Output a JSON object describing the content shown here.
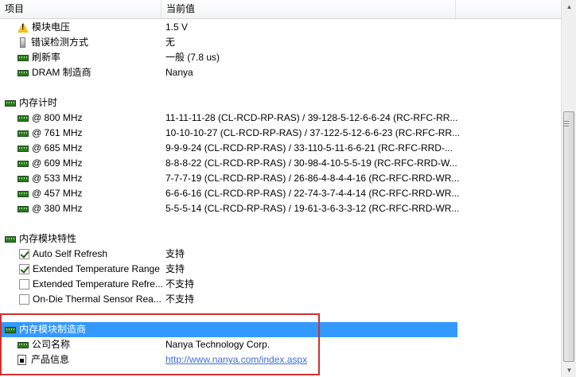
{
  "header": {
    "col_item": "项目",
    "col_value": "当前值"
  },
  "rows": [
    {
      "icon": "warning-icon",
      "label": "模块电压",
      "value": "1.5 V"
    },
    {
      "icon": "detection-icon",
      "label": "错误检测方式",
      "value": "无"
    },
    {
      "icon": "memory-icon",
      "label": "刷新率",
      "value": "一般 (7.8 us)"
    },
    {
      "icon": "memory-icon",
      "label": "DRAM 制造商",
      "value": "Nanya"
    },
    {
      "icon": "memory-icon",
      "label": "内存计时",
      "value": ""
    },
    {
      "icon": "memory-icon",
      "label": "@ 800 MHz",
      "value": "11-11-11-28  (CL-RCD-RP-RAS) / 39-128-5-12-6-6-24  (RC-RFC-RR..."
    },
    {
      "icon": "memory-icon",
      "label": "@ 761 MHz",
      "value": "10-10-10-27  (CL-RCD-RP-RAS) / 37-122-5-12-6-6-23  (RC-RFC-RR..."
    },
    {
      "icon": "memory-icon",
      "label": "@ 685 MHz",
      "value": "9-9-9-24  (CL-RCD-RP-RAS) / 33-110-5-11-6-6-21  (RC-RFC-RRD-..."
    },
    {
      "icon": "memory-icon",
      "label": "@ 609 MHz",
      "value": "8-8-8-22  (CL-RCD-RP-RAS) / 30-98-4-10-5-5-19  (RC-RFC-RRD-W..."
    },
    {
      "icon": "memory-icon",
      "label": "@ 533 MHz",
      "value": "7-7-7-19  (CL-RCD-RP-RAS) / 26-86-4-8-4-4-16  (RC-RFC-RRD-WR..."
    },
    {
      "icon": "memory-icon",
      "label": "@ 457 MHz",
      "value": "6-6-6-16  (CL-RCD-RP-RAS) / 22-74-3-7-4-4-14  (RC-RFC-RRD-WR..."
    },
    {
      "icon": "memory-icon",
      "label": "@ 380 MHz",
      "value": "5-5-5-14  (CL-RCD-RP-RAS) / 19-61-3-6-3-3-12  (RC-RFC-RRD-WR..."
    },
    {
      "icon": "memory-icon",
      "label": "内存模块特性",
      "value": ""
    },
    {
      "icon": "checkbox-checked",
      "label": "Auto Self Refresh",
      "value": "支持"
    },
    {
      "icon": "checkbox-checked",
      "label": "Extended Temperature Range",
      "value": "支持"
    },
    {
      "icon": "checkbox-unchecked",
      "label": "Extended Temperature Refre...",
      "value": "不支持"
    },
    {
      "icon": "checkbox-unchecked",
      "label": "On-Die Thermal Sensor Rea...",
      "value": "不支持"
    },
    {
      "icon": "memory-icon",
      "label": "内存模块制造商",
      "value": ""
    },
    {
      "icon": "memory-icon",
      "label": "公司名称",
      "value": "Nanya Technology Corp."
    },
    {
      "icon": "link-icon",
      "label": "产品信息",
      "value": "http://www.nanya.com/index.aspx"
    }
  ],
  "colors": {
    "selection": "#3399ff",
    "highlight_box": "#d03030",
    "link": "#3f6fd6"
  }
}
